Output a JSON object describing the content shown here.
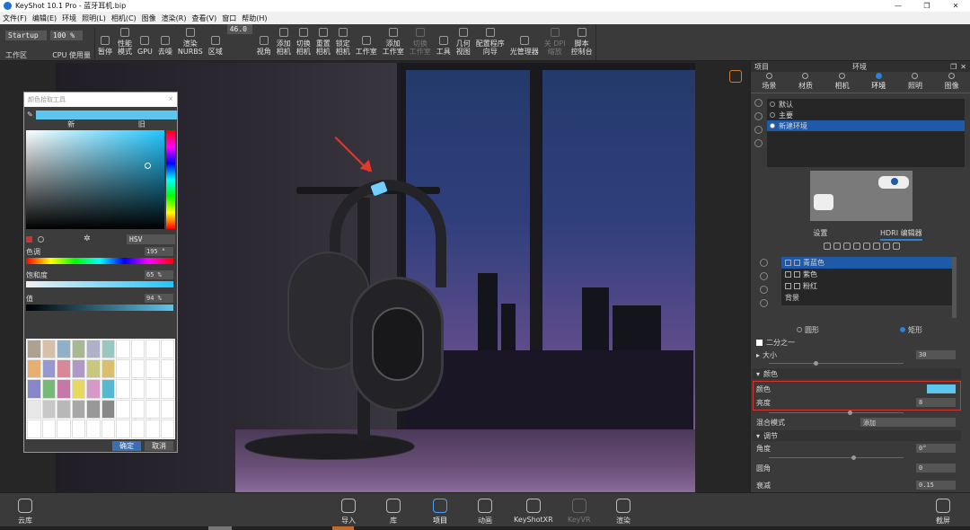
{
  "window": {
    "title": "KeyShot 10.1 Pro  -  蓝牙耳机.bip",
    "controls": [
      "—",
      "❐",
      "✕"
    ]
  },
  "menu": [
    "文件(F)",
    "编辑(E)",
    "环境",
    "照明(L)",
    "相机(C)",
    "图像",
    "渲染(R)",
    "查看(V)",
    "窗口",
    "帮助(H)"
  ],
  "ribbon": {
    "workspace_value": "Startup",
    "cpu_value": "100 %",
    "fov_value": "46.0",
    "workspace_label": "工作区",
    "cpu_label": "CPU 使用量",
    "items": [
      {
        "label": "暂停",
        "icon": "pause-icon"
      },
      {
        "label": "性能\n模式",
        "icon": "performance-icon"
      },
      {
        "label": "GPU",
        "icon": "gpu-icon"
      },
      {
        "label": "去噪",
        "icon": "denoise-icon"
      },
      {
        "label": "渲染\nNURBS",
        "icon": "nurbs-icon"
      },
      {
        "label": "区域",
        "icon": "region-icon"
      },
      {
        "label": "视角",
        "icon": "view-icon"
      },
      {
        "label": "添加\n相机",
        "icon": "add-camera-icon"
      },
      {
        "label": "切换\n相机",
        "icon": "switch-camera-icon"
      },
      {
        "label": "重置\n相机",
        "icon": "reset-camera-icon"
      },
      {
        "label": "锁定\n相机",
        "icon": "lock-camera-icon"
      },
      {
        "label": "工作室",
        "icon": "studio-icon"
      },
      {
        "label": "添加\n工作室",
        "icon": "add-studio-icon"
      },
      {
        "label": "切换\n工作室",
        "icon": "switch-studio-icon",
        "disabled": true
      },
      {
        "label": "工具",
        "icon": "tools-icon"
      },
      {
        "label": "几何\n视图",
        "icon": "geometry-view-icon"
      },
      {
        "label": "配置程序\n向导",
        "icon": "configurator-icon"
      },
      {
        "label": "光管理器",
        "icon": "light-manager-icon"
      },
      {
        "label": "关 DPI\n缩放",
        "icon": "dpi-icon",
        "disabled": true
      },
      {
        "label": "脚本\n控制台",
        "icon": "script-console-icon"
      }
    ]
  },
  "picker": {
    "title": "颜色拾取工具",
    "new_label": "新",
    "old_label": "旧",
    "mode": "HSV",
    "hue_label": "色调",
    "hue_value": "195 °",
    "saturation_label": "饱和度",
    "saturation_value": "65 %",
    "value_label": "值",
    "value_value": "94 %",
    "ok_label": "确定",
    "cancel_label": "取消",
    "current_color": "#5ec6ee",
    "swatches": [
      "#b0a090",
      "#d8c0a8",
      "#90b0c8",
      "#a8b890",
      "#b0b0c8",
      "#98c8c0",
      "#ffffff",
      "#ffffff",
      "#ffffff",
      "#ffffff",
      "#e8b070",
      "#9898d0",
      "#d88898",
      "#b098c8",
      "#c8c880",
      "#d8c070",
      "#ffffff",
      "#ffffff",
      "#ffffff",
      "#ffffff",
      "#8888c8",
      "#78b878",
      "#c878a8",
      "#e8d860",
      "#d898c8",
      "#58b8d0",
      "#ffffff",
      "#ffffff",
      "#ffffff",
      "#ffffff",
      "#e8e8e8",
      "#c8c8c8",
      "#b8b8b8",
      "#a8a8a8",
      "#989898",
      "#888888",
      "#ffffff",
      "#ffffff",
      "#ffffff",
      "#ffffff",
      "#ffffff",
      "#ffffff",
      "#ffffff",
      "#ffffff",
      "#ffffff",
      "#ffffff",
      "#ffffff",
      "#ffffff",
      "#ffffff",
      "#ffffff"
    ]
  },
  "panel": {
    "left_title": "项目",
    "center_title": "环境",
    "tabs": [
      {
        "label": "场景",
        "icon": "scene-icon"
      },
      {
        "label": "材质",
        "icon": "material-icon"
      },
      {
        "label": "相机",
        "icon": "camera-icon"
      },
      {
        "label": "环境",
        "icon": "environment-icon",
        "active": true
      },
      {
        "label": "照明",
        "icon": "lighting-icon"
      },
      {
        "label": "图像",
        "icon": "image-icon"
      }
    ],
    "environments": [
      {
        "label": "默认"
      },
      {
        "label": "主要"
      },
      {
        "label": "新建环境",
        "selected": true
      }
    ],
    "subtabs": [
      {
        "label": "设置"
      },
      {
        "label": "HDRI 编辑器",
        "active": true
      }
    ],
    "lights": [
      {
        "label": "青蓝色",
        "selected": true
      },
      {
        "label": "紫色"
      },
      {
        "label": "粉红"
      },
      {
        "label": "背景"
      }
    ],
    "shape_circle": "圆形",
    "shape_rect": "矩形",
    "half_label": "二分之一",
    "size_label": "大小",
    "size_value": "30",
    "color_section": "颜色",
    "color_label": "颜色",
    "brightness_label": "亮度",
    "brightness_value": "8",
    "blend_label": "混合模式",
    "blend_value": "添加",
    "adjust_section": "调节",
    "angle_label": "角度",
    "angle_value": "0°",
    "corner_label": "圆角",
    "corner_value": "0",
    "cut_label": "衰减",
    "cut_value": "0.15"
  },
  "bottom": {
    "cloud": "云库",
    "import": "导入",
    "library": "库",
    "project": "项目",
    "animation": "动画",
    "keyshotxr": "KeyShotXR",
    "keyvr": "KeyVR",
    "render": "渲染",
    "screenshot": "截屏"
  }
}
